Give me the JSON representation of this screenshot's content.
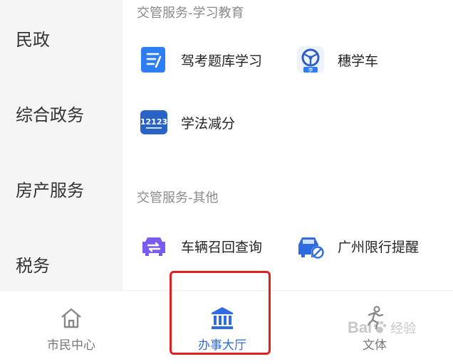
{
  "sidebar": {
    "items": [
      {
        "label": "民政"
      },
      {
        "label": "综合政务"
      },
      {
        "label": "房产服务"
      },
      {
        "label": "税务"
      }
    ]
  },
  "sections": [
    {
      "title": "交管服务-学习教育",
      "services": [
        {
          "label": "驾考题库学习",
          "icon": "exam-book-icon"
        },
        {
          "label": "穗学车",
          "icon": "steering-wheel-icon"
        },
        {
          "label": "学法减分",
          "icon": "12123-app-icon"
        }
      ]
    },
    {
      "title": "交管服务-其他",
      "services": [
        {
          "label": "车辆召回查询",
          "icon": "car-recall-icon"
        },
        {
          "label": "广州限行提醒",
          "icon": "car-restriction-icon"
        }
      ]
    }
  ],
  "icon_text": {
    "app12123": "12123",
    "xue": "学"
  },
  "tabbar": {
    "tabs": [
      {
        "label": "市民中心",
        "icon": "home-icon",
        "active": false
      },
      {
        "label": "办事大厅",
        "icon": "bank-building-icon",
        "active": true
      },
      {
        "label": "文体",
        "icon": "running-person-icon",
        "active": false
      }
    ]
  },
  "watermark": {
    "text": "Bai",
    "sub": "经验"
  },
  "colors": {
    "accent": "#2d6bdf",
    "inactive": "#777777",
    "highlight": "#e02020",
    "sidebar_bg": "#f5f5f5"
  }
}
